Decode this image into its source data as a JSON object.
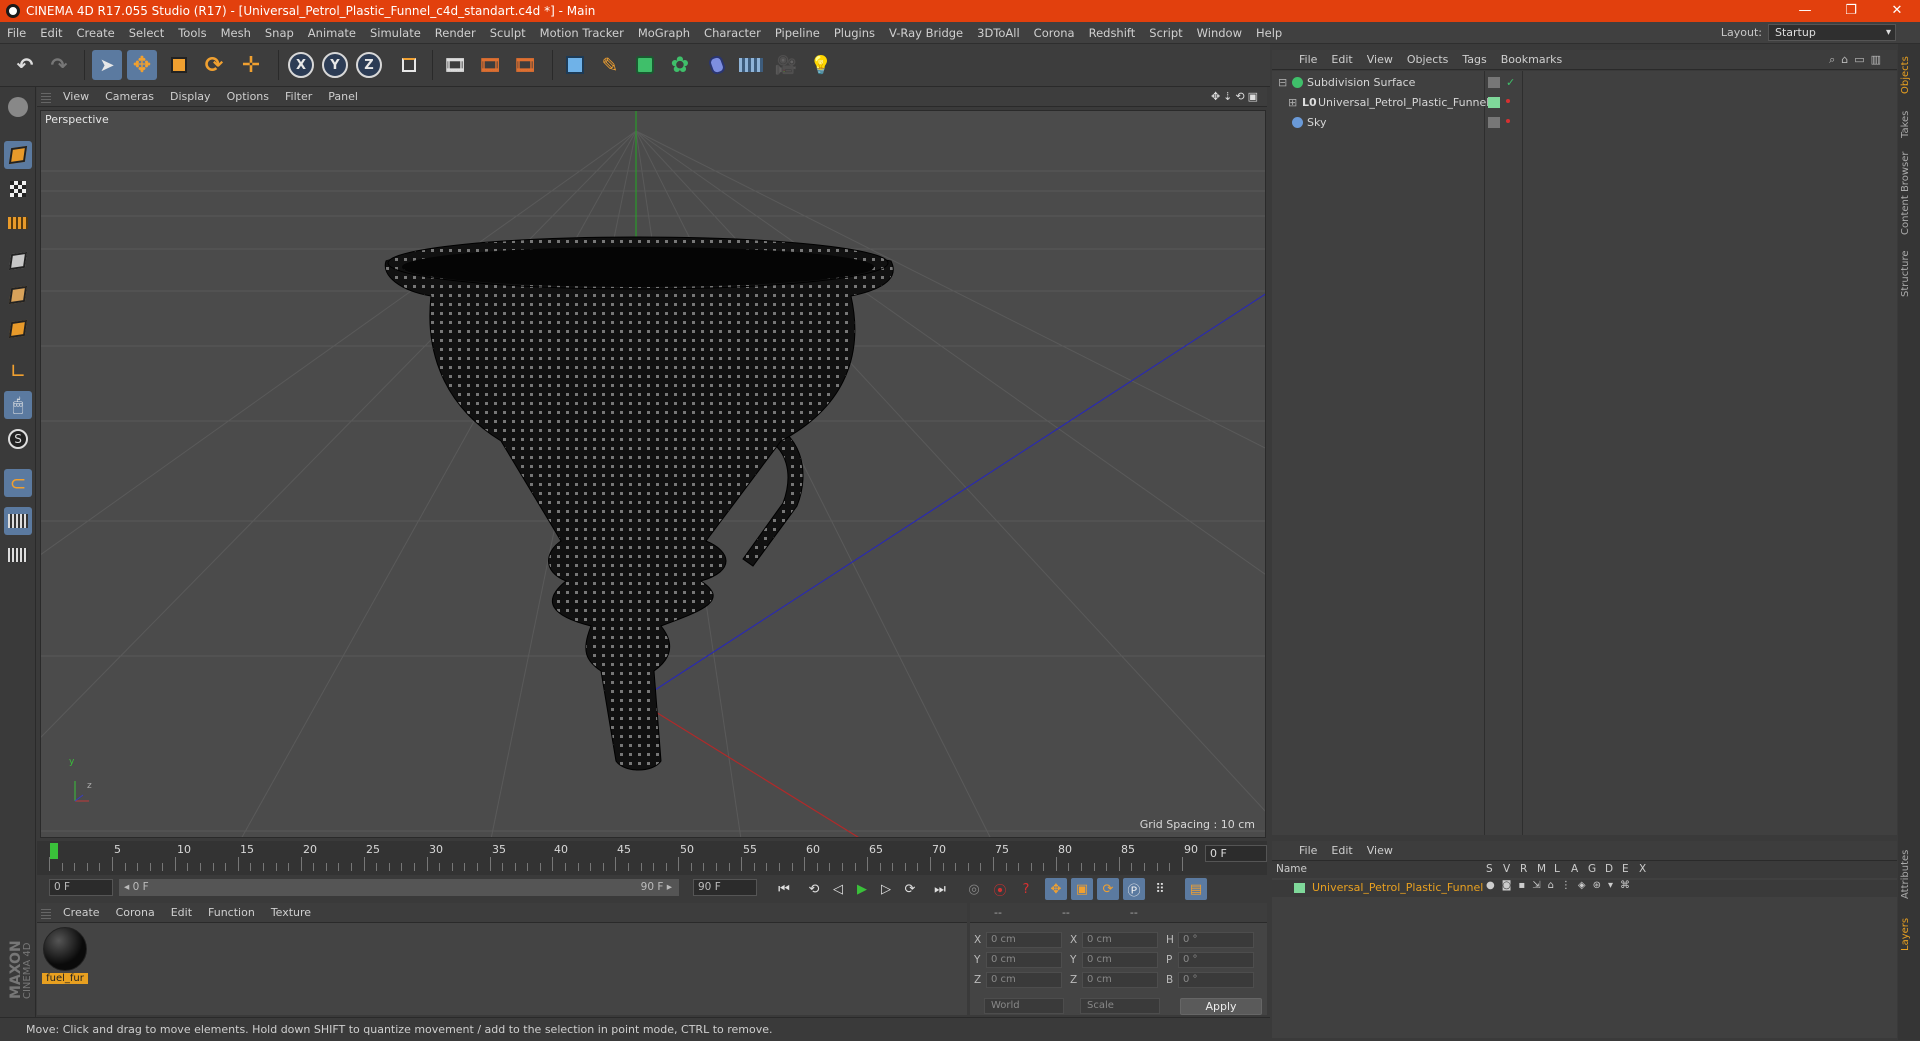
{
  "window": {
    "title": "CINEMA 4D R17.055 Studio (R17) - [Universal_Petrol_Plastic_Funnel_c4d_standart.c4d *] - Main",
    "controls": [
      "—",
      "❐",
      "✕"
    ]
  },
  "menubar": {
    "items": [
      "File",
      "Edit",
      "Create",
      "Select",
      "Tools",
      "Mesh",
      "Snap",
      "Animate",
      "Simulate",
      "Render",
      "Sculpt",
      "Motion Tracker",
      "MoGraph",
      "Character",
      "Pipeline",
      "Plugins",
      "V-Ray Bridge",
      "3DToAll",
      "Corona",
      "Redshift",
      "Script",
      "Window",
      "Help"
    ],
    "layout_label": "Layout:",
    "layout_value": "Startup"
  },
  "toolbar": {
    "axis_x": "X",
    "axis_y": "Y",
    "axis_z": "Z"
  },
  "viewport": {
    "menu": [
      "View",
      "Cameras",
      "Display",
      "Options",
      "Filter",
      "Panel"
    ],
    "label": "Perspective",
    "grid_spacing": "Grid Spacing : 10 cm",
    "axis_y": "y",
    "axis_z": "z"
  },
  "timeline": {
    "ticks": [
      "0",
      "5",
      "10",
      "15",
      "20",
      "25",
      "30",
      "35",
      "40",
      "45",
      "50",
      "55",
      "60",
      "65",
      "70",
      "75",
      "80",
      "85",
      "90"
    ],
    "current_frame": "0 F",
    "start_field": "0 F",
    "range_left": "◂ 0 F",
    "range_right": "90 F ▸",
    "end_field": "90 F",
    "end_field2": "90 F"
  },
  "materials": {
    "menu": [
      "Create",
      "Corona",
      "Edit",
      "Function",
      "Texture"
    ],
    "items": [
      {
        "name": "fuel_fur"
      }
    ]
  },
  "coordinates": {
    "head": [
      "--",
      "--",
      "--"
    ],
    "rows": [
      {
        "l1": "X",
        "v1": "0 cm",
        "l2": "X",
        "v2": "0 cm",
        "l3": "H",
        "v3": "0 °"
      },
      {
        "l1": "Y",
        "v1": "0 cm",
        "l2": "Y",
        "v2": "0 cm",
        "l3": "P",
        "v3": "0 °"
      },
      {
        "l1": "Z",
        "v1": "0 cm",
        "l2": "Z",
        "v2": "0 cm",
        "l3": "B",
        "v3": "0 °"
      }
    ],
    "mode": "World",
    "transform": "Scale",
    "apply": "Apply"
  },
  "status": "Move: Click and drag to move elements. Hold down SHIFT to quantize movement / add to the selection in point mode, CTRL to remove.",
  "objects": {
    "menu": [
      "File",
      "Edit",
      "View",
      "Objects",
      "Tags",
      "Bookmarks"
    ],
    "rows": [
      {
        "name": "Subdivision Surface",
        "icon_color": "#3fbf6a"
      },
      {
        "name": "Universal_Petrol_Plastic_Funnel",
        "icon_color": "#cfcfcf"
      },
      {
        "name": "Sky",
        "icon_color": "#6a9ad8"
      }
    ]
  },
  "layers": {
    "menu": [
      "File",
      "Edit",
      "View"
    ],
    "head_name": "Name",
    "head_cols": [
      "S",
      "V",
      "R",
      "M",
      "L",
      "A",
      "G",
      "D",
      "E",
      "X"
    ],
    "rows": [
      {
        "name": "Universal_Petrol_Plastic_Funnel",
        "color": "#7fd89a"
      }
    ]
  },
  "right_tabs": [
    "Objects",
    "Takes",
    "Content Browser",
    "Structure",
    "Attributes",
    "Layers"
  ],
  "maxon": {
    "line1": "MAXON",
    "line2": "CINEMA 4D"
  }
}
